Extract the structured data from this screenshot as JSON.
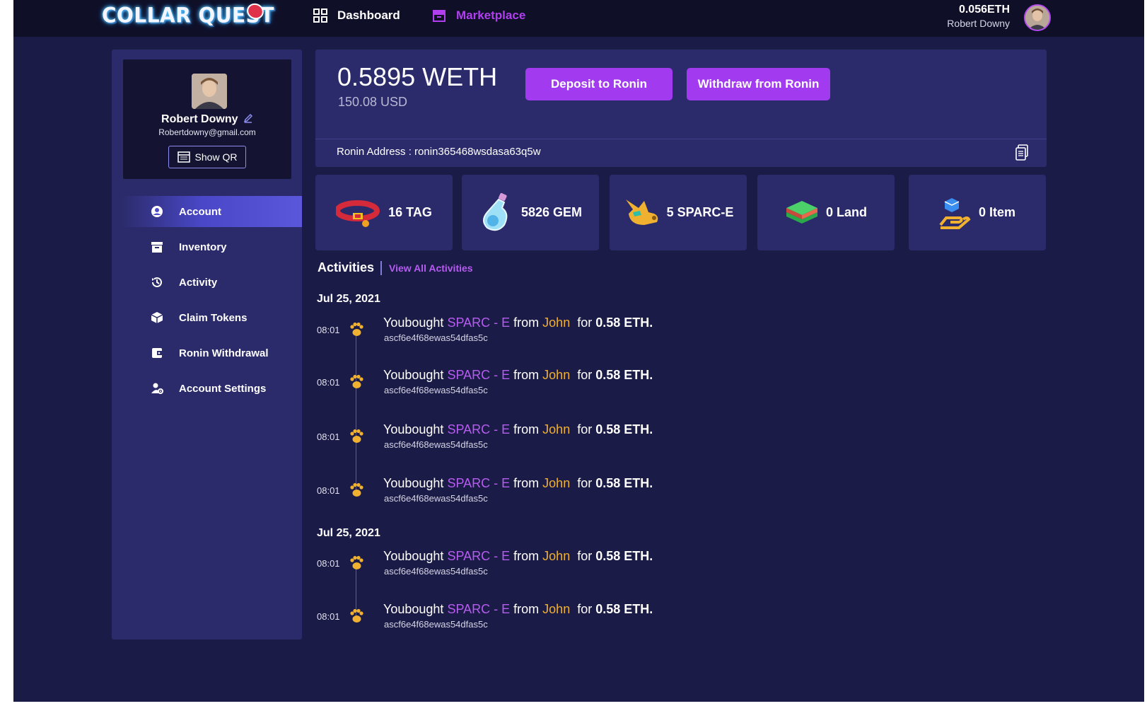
{
  "topbar": {
    "logo": "COLLAR QUEST",
    "nav": [
      {
        "label": "Dashboard",
        "icon": "grid-icon"
      },
      {
        "label": "Marketplace",
        "icon": "store-icon"
      }
    ],
    "balance": "0.056ETH",
    "user_name": "Robert Downy"
  },
  "profile": {
    "name": "Robert Downy",
    "email": "Robertdowny@gmail.com",
    "qr_label": "Show QR"
  },
  "menu": [
    {
      "label": "Account",
      "icon": "user-circle-icon",
      "active": true
    },
    {
      "label": "Inventory",
      "icon": "archive-box-icon",
      "active": false
    },
    {
      "label": "Activity",
      "icon": "history-icon",
      "active": false
    },
    {
      "label": "Claim Tokens",
      "icon": "cube-icon",
      "active": false
    },
    {
      "label": "Ronin Withdrawal",
      "icon": "wallet-icon",
      "active": false
    },
    {
      "label": "Account Settings",
      "icon": "user-gear-icon",
      "active": false
    }
  ],
  "wallet": {
    "amount": "0.5895 WETH",
    "usd": "150.08 USD",
    "deposit_label": "Deposit to Ronin",
    "withdraw_label": "Withdraw from Ronin",
    "address": "Ronin Address : ronin365468wsdasa63q5w"
  },
  "stats": [
    {
      "label": "16 TAG",
      "icon": "collar-icon"
    },
    {
      "label": "5826 GEM",
      "icon": "potion-icon"
    },
    {
      "label": "5 SPARC-E",
      "icon": "dog-head-icon"
    },
    {
      "label": "0 Land",
      "icon": "land-icon"
    },
    {
      "label": "0 Item",
      "icon": "item-hand-icon"
    }
  ],
  "activities": {
    "title": "Activities",
    "view_all": "View All Activities",
    "groups": [
      {
        "date": "Jul 25, 2021",
        "rows": [
          {
            "time": "08:01",
            "prefix": "Youbought",
            "item": "SPARC - E",
            "from": "from",
            "who": "John",
            "for": "for",
            "price": "0.58 ETH.",
            "hash": "ascf6e4f68ewas54dfas5c"
          },
          {
            "time": "08:01",
            "prefix": "Youbought",
            "item": "SPARC - E",
            "from": "from",
            "who": "John",
            "for": "for",
            "price": "0.58 ETH.",
            "hash": "ascf6e4f68ewas54dfas5c"
          },
          {
            "time": "08:01",
            "prefix": "Youbought",
            "item": "SPARC - E",
            "from": "from",
            "who": "John",
            "for": "for",
            "price": "0.58 ETH.",
            "hash": "ascf6e4f68ewas54dfas5c"
          },
          {
            "time": "08:01",
            "prefix": "Youbought",
            "item": "SPARC - E",
            "from": "from",
            "who": "John",
            "for": "for",
            "price": "0.58 ETH.",
            "hash": "ascf6e4f68ewas54dfas5c"
          }
        ]
      },
      {
        "date": "Jul 25, 2021",
        "rows": [
          {
            "time": "08:01",
            "prefix": "Youbought",
            "item": "SPARC - E",
            "from": "from",
            "who": "John",
            "for": "for",
            "price": "0.58 ETH.",
            "hash": "ascf6e4f68ewas54dfas5c"
          },
          {
            "time": "08:01",
            "prefix": "Youbought",
            "item": "SPARC - E",
            "from": "from",
            "who": "John",
            "for": "for",
            "price": "0.58 ETH.",
            "hash": "ascf6e4f68ewas54dfas5c"
          }
        ]
      }
    ]
  },
  "colors": {
    "accent": "#a23af0",
    "panel": "#2b2b6b",
    "background": "#1b1b47",
    "topbar": "#0f0f28",
    "highlight_name": "#f0b030"
  }
}
